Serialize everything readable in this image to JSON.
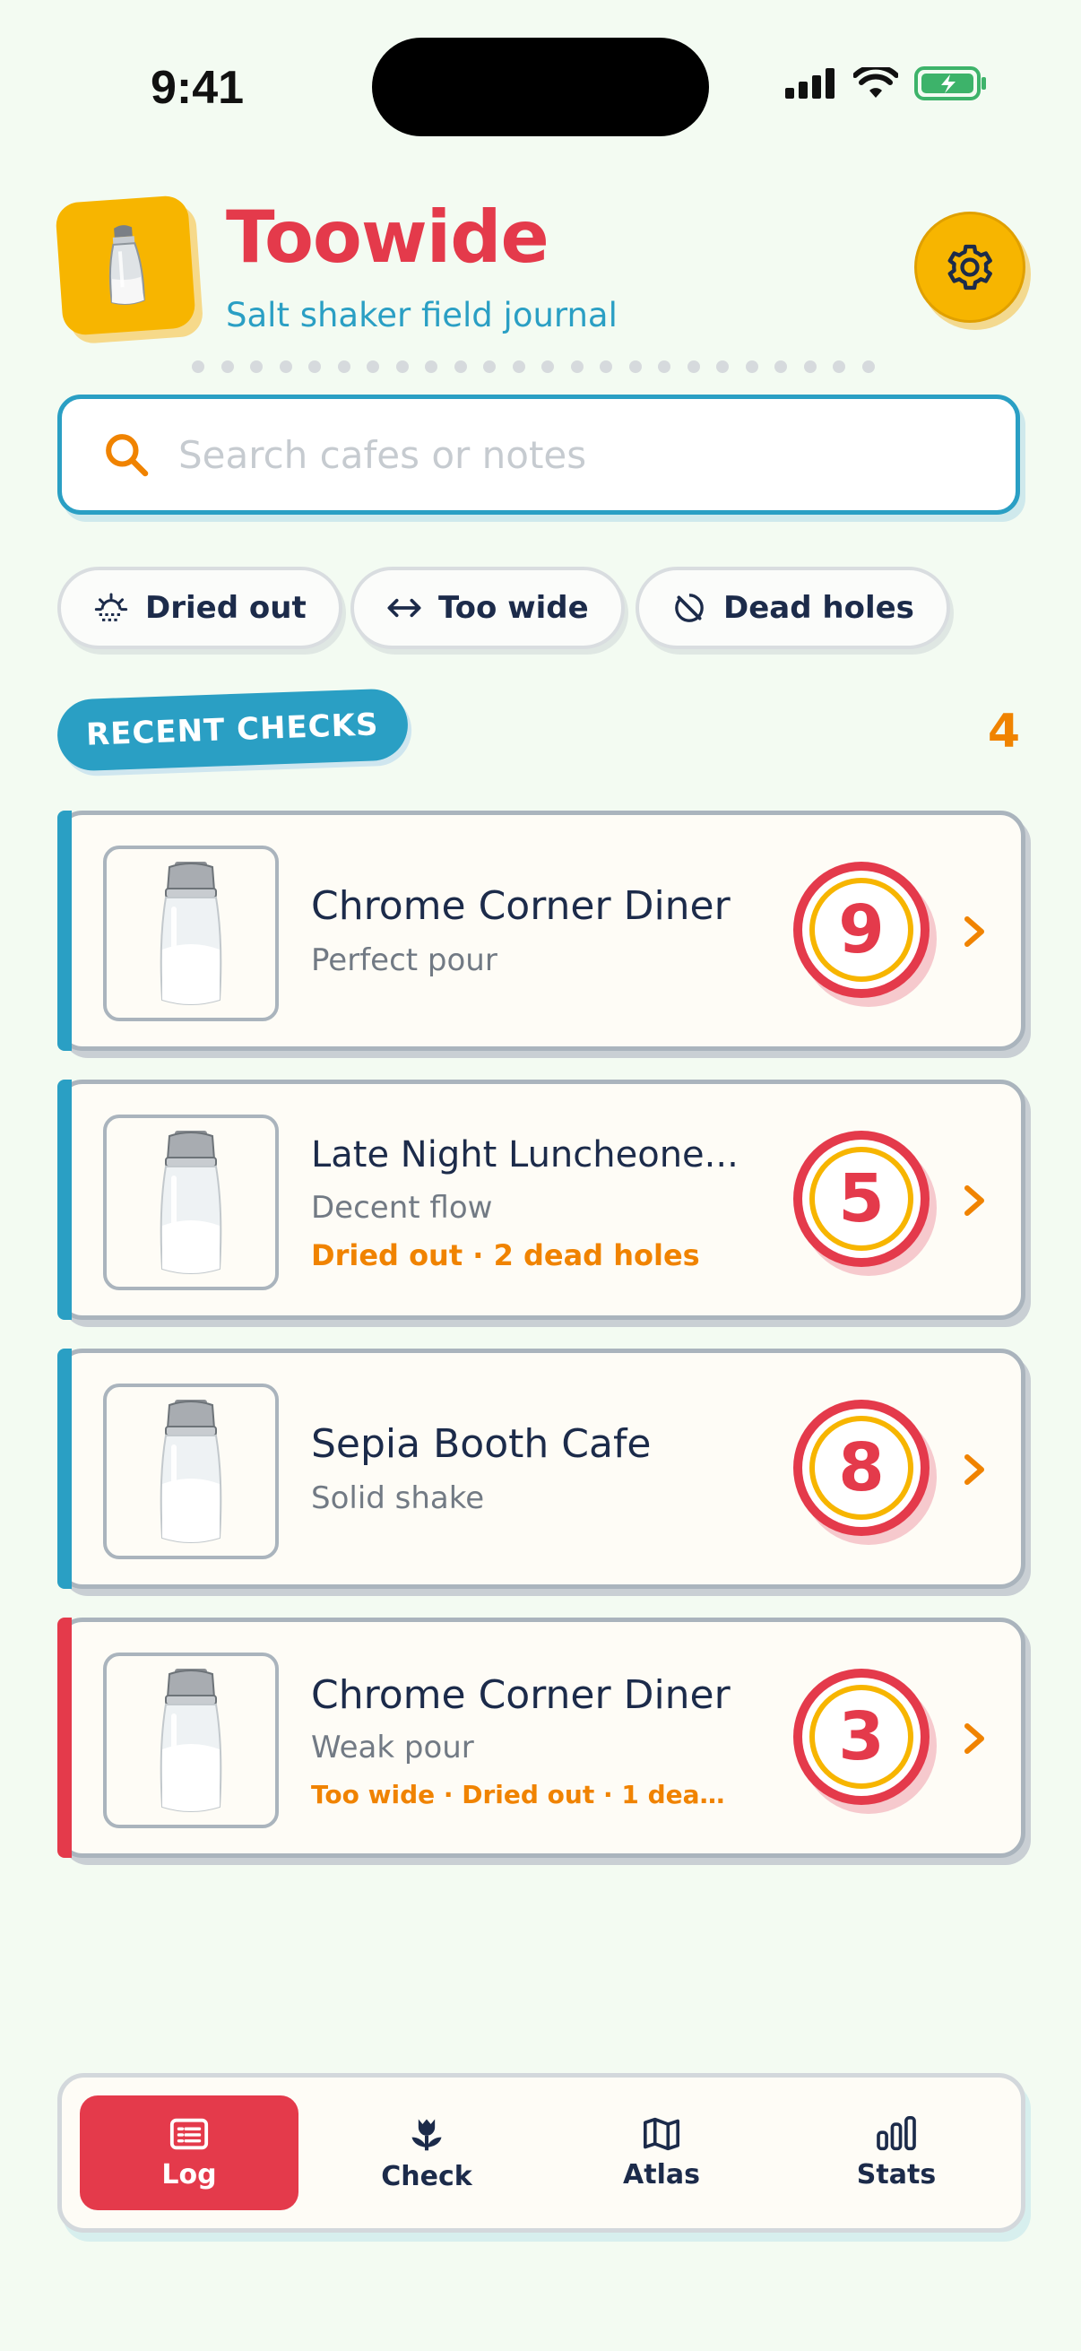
{
  "status_bar": {
    "time": "9:41"
  },
  "header": {
    "title": "Toowide",
    "subtitle": "Salt shaker field journal",
    "settings_icon": "gear-icon"
  },
  "search": {
    "placeholder": "Search cafes or notes",
    "value": ""
  },
  "filters": [
    {
      "label": "Dried out",
      "icon": "sun-dry-icon"
    },
    {
      "label": "Too wide",
      "icon": "arrows-horizontal-icon"
    },
    {
      "label": "Dead holes",
      "icon": "blocked-circle-icon"
    }
  ],
  "section": {
    "title": "RECENT CHECKS",
    "count": "4"
  },
  "checks": [
    {
      "name": "Chrome Corner Diner",
      "description": "Perfect pour",
      "issues": "",
      "score": "9",
      "accent": "#2a9fc4"
    },
    {
      "name": "Late Night Luncheone...",
      "description": "Decent flow",
      "issues": "Dried out · 2 dead holes",
      "score": "5",
      "accent": "#2a9fc4"
    },
    {
      "name": "Sepia Booth Cafe",
      "description": "Solid shake",
      "issues": "",
      "score": "8",
      "accent": "#2a9fc4"
    },
    {
      "name": "Chrome Corner Diner",
      "description": "Weak pour",
      "issues": "Too wide · Dried out · 1 dead h...",
      "score": "3",
      "accent": "#e43a4b"
    }
  ],
  "nav": [
    {
      "label": "Log",
      "icon": "list-icon",
      "active": true
    },
    {
      "label": "Check",
      "icon": "tulip-icon",
      "active": false
    },
    {
      "label": "Atlas",
      "icon": "map-icon",
      "active": false
    },
    {
      "label": "Stats",
      "icon": "bar-chart-icon",
      "active": false
    }
  ],
  "colors": {
    "brand_red": "#e43a4b",
    "brand_blue": "#2a9fc4",
    "brand_yellow": "#f7b500",
    "accent_orange": "#f08300"
  }
}
